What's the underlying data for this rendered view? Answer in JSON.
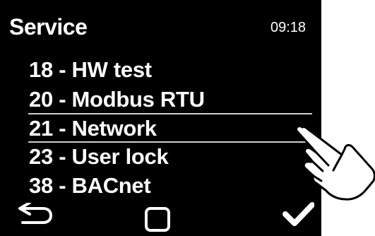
{
  "header": {
    "title": "Service",
    "time": "09:18"
  },
  "menu": {
    "items": [
      {
        "label": "18 - HW test"
      },
      {
        "label": "20 - Modbus RTU"
      },
      {
        "label": "21 - Network",
        "selected": true
      },
      {
        "label": "23 - User lock"
      },
      {
        "label": "38 - BACnet"
      }
    ]
  },
  "footer": {
    "back_icon": "back-arrow-icon",
    "home_icon": "square-home-icon",
    "confirm_icon": "checkmark-icon"
  },
  "overlay": {
    "hand_icon": "pointing-hand-icon"
  },
  "colors": {
    "screen_background": "#000000",
    "text": "#ffffff",
    "selection_line": "#cfcfcf",
    "page_background": "#ffffff"
  }
}
